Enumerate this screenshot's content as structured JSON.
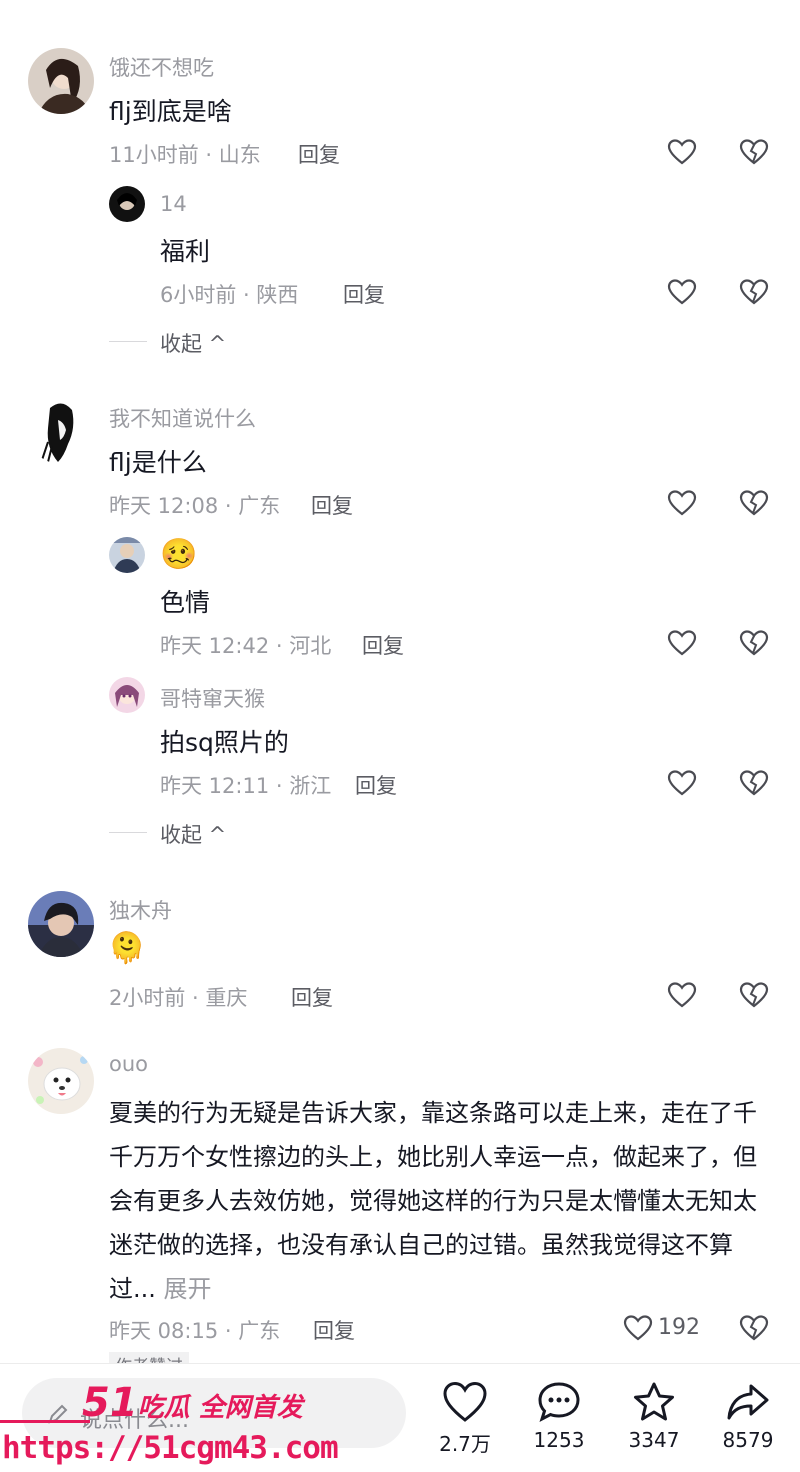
{
  "comments": [
    {
      "user": "饿还不想吃",
      "text": "flj到底是啥",
      "meta": "11小时前 · 山东",
      "reply_label": "回复",
      "replies": [
        {
          "user": "14",
          "text": "福利",
          "meta": "6小时前 · 陕西",
          "reply_label": "回复"
        }
      ],
      "collapse_label": "收起 ^"
    },
    {
      "user": "我不知道说什么",
      "text": "flj是什么",
      "meta": "昨天 12:08 · 广东",
      "reply_label": "回复",
      "replies": [
        {
          "user": "🥴",
          "text": "色情",
          "meta": "昨天 12:42 · 河北",
          "reply_label": "回复"
        },
        {
          "user": "哥特窜天猴",
          "text": "拍sq照片的",
          "meta": "昨天 12:11 · 浙江",
          "reply_label": "回复"
        }
      ],
      "collapse_label": "收起 ^"
    },
    {
      "user": "独木舟",
      "text": "🫠",
      "meta": "2小时前 · 重庆",
      "reply_label": "回复"
    },
    {
      "user": "ouo",
      "text": "夏美的行为无疑是告诉大家，靠这条路可以走上来，走在了千千万万个女性擦边的头上，她比别人幸运一点，做起来了，但会有更多人去效仿她，觉得她这样的行为只是太懵懂太无知太迷茫做的选择，也没有承认自己的过错。虽然我觉得这不算过...",
      "expand_label": "展开",
      "meta": "昨天 08:15 · 广东",
      "reply_label": "回复",
      "like_count": "192",
      "badge": "作者赞过"
    }
  ],
  "bottom_bar": {
    "input_placeholder": "说点什么...",
    "actions": [
      {
        "icon": "heart-icon",
        "count": "2.7万"
      },
      {
        "icon": "comment-icon",
        "count": "1253"
      },
      {
        "icon": "star-icon",
        "count": "3347"
      },
      {
        "icon": "share-icon",
        "count": "8579"
      }
    ]
  },
  "watermark": {
    "brand_number": "51",
    "brand_text": "吃瓜 全网首发",
    "url": "https://51cgm43.com"
  },
  "colors": {
    "text_primary": "#161823",
    "text_secondary": "#9a9ba1",
    "watermark": "#e51a5b"
  }
}
